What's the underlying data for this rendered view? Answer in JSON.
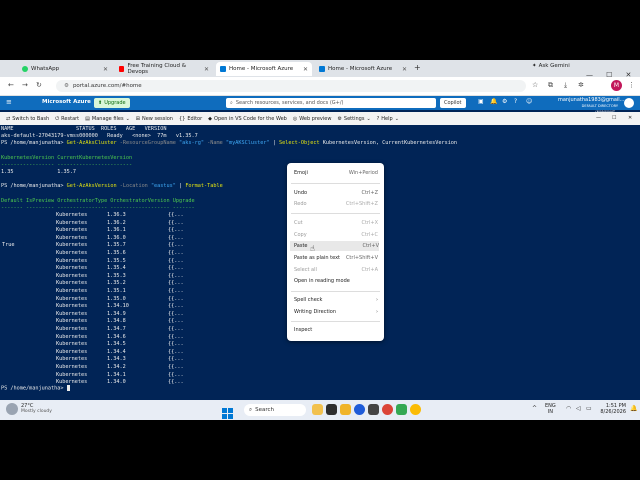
{
  "tabs": [
    {
      "label": "WhatsApp",
      "color": "#25d366"
    },
    {
      "label": "Free Training Cloud & Devops",
      "color": "#ff0000"
    },
    {
      "label": "Home - Microsoft Azure",
      "color": "#0078d4"
    },
    {
      "label": "Home - Microsoft Azure",
      "color": "#0078d4"
    }
  ],
  "new_tab": "+",
  "browser": {
    "ask_gemini": "Ask Gemini",
    "url": "portal.azure.com/#home",
    "profile_initial": "M"
  },
  "azure": {
    "brand": "Microsoft Azure",
    "upgrade": "Upgrade",
    "search_placeholder": "Search resources, services, and docs (G+/)",
    "copilot": "Copilot",
    "user_email": "manjunatha1983@gmail....",
    "user_directory": "DEFAULT DIRECTORY (MANJUNAT..."
  },
  "shell_toolbar": {
    "mode": "Switch to Bash",
    "restart": "Restart",
    "manage_files": "Manage files",
    "new_session": "New session",
    "editor": "Editor",
    "vscode": "Open in VS Code for the Web",
    "web_preview": "Web preview",
    "settings": "Settings",
    "help": "Help"
  },
  "terminal": {
    "header_cols": "NAME                    STATUS  ROLES   AGE   VERSION",
    "node_row": "aks-default-27043179-vmss000000   Ready   <none>  77m   v1.35.7",
    "prompt": "PS /home/manjunatha> ",
    "cmd1_name": "Get-AzAksCluster",
    "cmd1_p1": " -ResourceGroupName ",
    "cmd1_v1": "\"aks-rg\"",
    "cmd1_p2": " -Name ",
    "cmd1_v2": "\"myAKSCluster\"",
    "cmd1_pipe": " | ",
    "cmd1_name2": "Select-Object",
    "cmd1_rest": " KubernetesVersion, CurrentKubernetesVersion",
    "out1_header": "KubernetesVersion CurrentKubernetesVersion",
    "out1_dash": "----------------- ------------------------",
    "out1_row": "1.35              1.35.7",
    "cmd2_name": "Get-AzAksVersion",
    "cmd2_p1": " -Location ",
    "cmd2_v1": "\"eastus\"",
    "cmd2_pipe": " | ",
    "cmd2_name2": "Format-Table",
    "out2_header": "Default IsPreview OrchestratorType OrchestratorVersion Upgrade",
    "out2_dash": "------- --------- ---------------- ------------------- -------",
    "rows": [
      {
        "default": "",
        "type": "Kubernetes",
        "version": "1.36.3",
        "upgrade": "{{..."
      },
      {
        "default": "",
        "type": "Kubernetes",
        "version": "1.36.2",
        "upgrade": "{{..."
      },
      {
        "default": "",
        "type": "Kubernetes",
        "version": "1.36.1",
        "upgrade": "{{..."
      },
      {
        "default": "",
        "type": "Kubernetes",
        "version": "1.36.0",
        "upgrade": "{{..."
      },
      {
        "default": "True",
        "type": "Kubernetes",
        "version": "1.35.7",
        "upgrade": "{{..."
      },
      {
        "default": "",
        "type": "Kubernetes",
        "version": "1.35.6",
        "upgrade": "{{..."
      },
      {
        "default": "",
        "type": "Kubernetes",
        "version": "1.35.5",
        "upgrade": "{{..."
      },
      {
        "default": "",
        "type": "Kubernetes",
        "version": "1.35.4",
        "upgrade": "{{..."
      },
      {
        "default": "",
        "type": "Kubernetes",
        "version": "1.35.3",
        "upgrade": "{{..."
      },
      {
        "default": "",
        "type": "Kubernetes",
        "version": "1.35.2",
        "upgrade": "{{..."
      },
      {
        "default": "",
        "type": "Kubernetes",
        "version": "1.35.1",
        "upgrade": "{{..."
      },
      {
        "default": "",
        "type": "Kubernetes",
        "version": "1.35.0",
        "upgrade": "{{..."
      },
      {
        "default": "",
        "type": "Kubernetes",
        "version": "1.34.10",
        "upgrade": "{{..."
      },
      {
        "default": "",
        "type": "Kubernetes",
        "version": "1.34.9",
        "upgrade": "{{..."
      },
      {
        "default": "",
        "type": "Kubernetes",
        "version": "1.34.8",
        "upgrade": "{{..."
      },
      {
        "default": "",
        "type": "Kubernetes",
        "version": "1.34.7",
        "upgrade": "{{..."
      },
      {
        "default": "",
        "type": "Kubernetes",
        "version": "1.34.6",
        "upgrade": "{{..."
      },
      {
        "default": "",
        "type": "Kubernetes",
        "version": "1.34.5",
        "upgrade": "{{..."
      },
      {
        "default": "",
        "type": "Kubernetes",
        "version": "1.34.4",
        "upgrade": "{{..."
      },
      {
        "default": "",
        "type": "Kubernetes",
        "version": "1.34.3",
        "upgrade": "{{..."
      },
      {
        "default": "",
        "type": "Kubernetes",
        "version": "1.34.2",
        "upgrade": "{{..."
      },
      {
        "default": "",
        "type": "Kubernetes",
        "version": "1.34.1",
        "upgrade": "{{..."
      },
      {
        "default": "",
        "type": "Kubernetes",
        "version": "1.34.0",
        "upgrade": "{{..."
      }
    ]
  },
  "context_menu": {
    "items": [
      {
        "label": "Emoji",
        "shortcut": "Win+Period",
        "enabled": true
      },
      {
        "label": "Undo",
        "shortcut": "Ctrl+Z",
        "enabled": true
      },
      {
        "label": "Redo",
        "shortcut": "Ctrl+Shift+Z",
        "enabled": false
      },
      {
        "label": "Cut",
        "shortcut": "Ctrl+X",
        "enabled": false
      },
      {
        "label": "Copy",
        "shortcut": "Ctrl+C",
        "enabled": false
      },
      {
        "label": "Paste",
        "shortcut": "Ctrl+V",
        "enabled": true
      },
      {
        "label": "Paste as plain text",
        "shortcut": "Ctrl+Shift+V",
        "enabled": true
      },
      {
        "label": "Select all",
        "shortcut": "Ctrl+A",
        "enabled": false
      },
      {
        "label": "Open in reading mode",
        "shortcut": "",
        "enabled": true
      },
      {
        "label": "Spell check",
        "shortcut": "›",
        "enabled": true
      },
      {
        "label": "Writing Direction",
        "shortcut": "›",
        "enabled": true
      },
      {
        "label": "Inspect",
        "shortcut": "",
        "enabled": true
      }
    ]
  },
  "taskbar": {
    "weather_temp": "27°C",
    "weather_desc": "Mostly cloudy",
    "search": "Search",
    "lang_top": "ENG",
    "lang_bottom": "IN",
    "time": "1:51 PM",
    "date": "8/26/2026"
  }
}
